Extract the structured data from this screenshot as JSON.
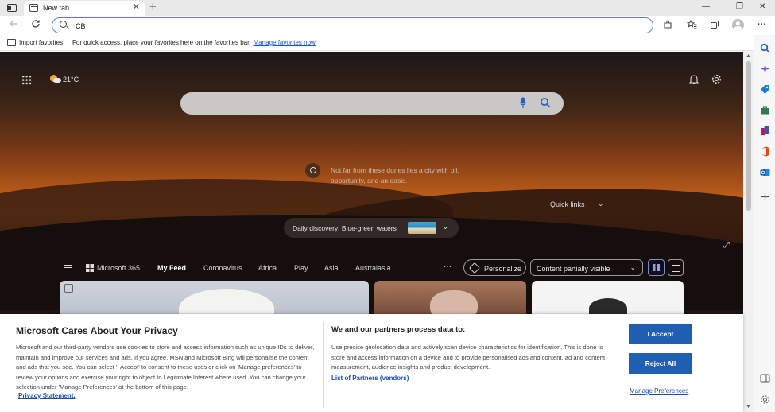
{
  "browser": {
    "tab_title": "New tab",
    "tab_close": "✕",
    "new_tab": "+",
    "address_value": "CB",
    "controls": {
      "minimize": "—",
      "restore": "❐",
      "close": "✕"
    },
    "more": "···"
  },
  "favorites_bar": {
    "import_label": "Import favorites",
    "hint": "For quick access, place your favorites here on the favorites bar.",
    "manage_link": "Manage favorites now"
  },
  "ntp": {
    "weather_temp": "21°C",
    "caption": "Not far from these dunes lies a city with oil, opportunity, and an oasis.",
    "quick_links": "Quick links",
    "daily_discovery": "Daily discovery: Blue-green waters",
    "feed_nav": {
      "microsoft365": "Microsoft 365",
      "my_feed": "My Feed",
      "coronavirus": "Coronavirus",
      "africa": "Africa",
      "play": "Play",
      "asia": "Asia",
      "australasia": "Australasia",
      "more": "···"
    },
    "personalize": "Personalize",
    "content_visibility": "Content partially visible"
  },
  "privacy": {
    "title": "Microsoft Cares About Your Privacy",
    "body": "Microsoft and our third-party vendors use cookies to store and access information such as unique IDs to deliver, maintain and improve our services and ads. If you agree, MSN and Microsoft Bing will personalise the content and ads that you see. You can select 'I Accept' to consent to these uses or click on 'Manage preferences' to review your options and exercise your right to object to Legitimate Interest where used. You can change your selection under 'Manage Preferences' at the bottom of this page.",
    "privacy_link": "Privacy Statement.",
    "partners_title": "We and our partners process data to:",
    "partners_body": "Use precise geolocation data and actively scan device characteristics for identification. This is done to store and access information on a device and to provide personalised ads and content, ad and content measurement, audience insights and product development.",
    "partners_link": "List of Partners (vendors)",
    "accept": "I Accept",
    "reject": "Reject All",
    "manage": "Manage Preferences"
  },
  "colors": {
    "accent": "#1e5fb4",
    "link": "#1a55c9",
    "address_border": "#5b7bd6"
  }
}
